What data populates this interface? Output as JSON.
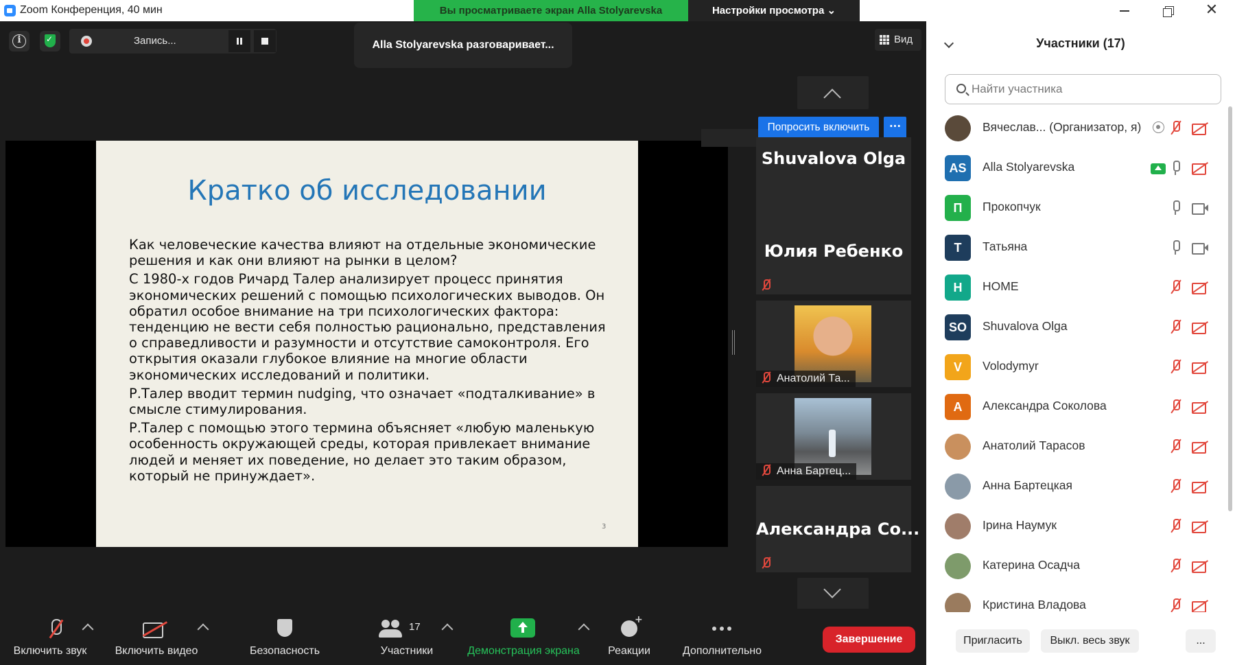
{
  "window": {
    "title": "Zoom Конференция, 40 мин"
  },
  "banner": {
    "viewing": "Вы просматриваете экран Alla Stolyarevska",
    "view_settings": "Настройки просмотра ⌄"
  },
  "recording": {
    "label": "Запись..."
  },
  "speaker_tooltip": "Alla Stolyarevska разговаривает...",
  "view_button": "Вид",
  "slide": {
    "title": "Кратко об исследовании",
    "paragraphs": [
      "Как человеческие качества влияют на отдельные экономические решения и как они влияют на рынки в целом?",
      "С 1980-х годов Ричард Талер анализирует процесс принятия экономических решений с помощью психологических выводов. Он обратил особое внимание на три психологических фактора: тенденцию не вести себя полностью рационально, представления о справедливости и разумности и отсутствие самоконтроля. Его открытия оказали глубокое влияние на многие области экономических исследований и политики.",
      "Р.Талер вводит термин nudging, что означает «подталкивание» в смысле стимулирования.",
      "Р.Талер с помощью этого термина объясняет «любую маленькую особенность окружающей среды, которая привлекает внимание людей и меняет их поведение, но делает это таким образом, который не принуждает»."
    ],
    "page_number": "3"
  },
  "gallery": {
    "ask_unmute": "Попросить включить",
    "more": "···",
    "tiles": [
      {
        "name": "Shuvalova Olga"
      },
      {
        "name": "Юлия Ребенко"
      },
      {
        "name": "Анатолий Та..."
      },
      {
        "name": "Анна Бартец..."
      },
      {
        "name": "Александра Со..."
      }
    ]
  },
  "toolbar": {
    "audio": "Включить звук",
    "video": "Включить видео",
    "security": "Безопасность",
    "participants": "Участники",
    "participants_count": "17",
    "share": "Демонстрация экрана",
    "reactions": "Реакции",
    "more": "Дополнительно",
    "end": "Завершение"
  },
  "panel": {
    "title": "Участники (17)",
    "search_placeholder": "Найти участника",
    "participants": [
      {
        "name": "Вячеслав... (Организатор, я)",
        "initials": "",
        "color": "#5a4a3a",
        "mic": "off",
        "cam": "off",
        "badge": "record"
      },
      {
        "name": "Alla Stolyarevska",
        "initials": "AS",
        "color": "#1f6fb0",
        "mic": "on",
        "cam": "off",
        "badge": "share"
      },
      {
        "name": "Прокопчук",
        "initials": "П",
        "color": "#23b04b",
        "mic": "on",
        "cam": "on",
        "badge": ""
      },
      {
        "name": "Татьяна",
        "initials": "T",
        "color": "#1e3d5c",
        "mic": "on",
        "cam": "on",
        "badge": ""
      },
      {
        "name": "HOME",
        "initials": "H",
        "color": "#12a88a",
        "mic": "off",
        "cam": "off",
        "badge": ""
      },
      {
        "name": "Shuvalova Olga",
        "initials": "SO",
        "color": "#1e3d5c",
        "mic": "off",
        "cam": "off",
        "badge": ""
      },
      {
        "name": "Volodymyr",
        "initials": "V",
        "color": "#f2a51a",
        "mic": "off",
        "cam": "off",
        "badge": ""
      },
      {
        "name": "Александра Соколова",
        "initials": "A",
        "color": "#e06a12",
        "mic": "off",
        "cam": "off",
        "badge": ""
      },
      {
        "name": "Анатолий Тарасов",
        "initials": "",
        "color": "#c9905e",
        "mic": "off",
        "cam": "off",
        "badge": ""
      },
      {
        "name": "Анна Бартецкая",
        "initials": "",
        "color": "#8a9aa8",
        "mic": "off",
        "cam": "off",
        "badge": ""
      },
      {
        "name": "Ірина Наумук",
        "initials": "",
        "color": "#a07d6a",
        "mic": "off",
        "cam": "off",
        "badge": ""
      },
      {
        "name": "Катерина Осадча",
        "initials": "",
        "color": "#7e9b6b",
        "mic": "off",
        "cam": "off",
        "badge": ""
      },
      {
        "name": "Кристина Владова",
        "initials": "",
        "color": "#9a7b5e",
        "mic": "off",
        "cam": "off",
        "badge": ""
      }
    ],
    "invite": "Пригласить",
    "mute_all": "Выкл. весь звук",
    "more": "..."
  }
}
